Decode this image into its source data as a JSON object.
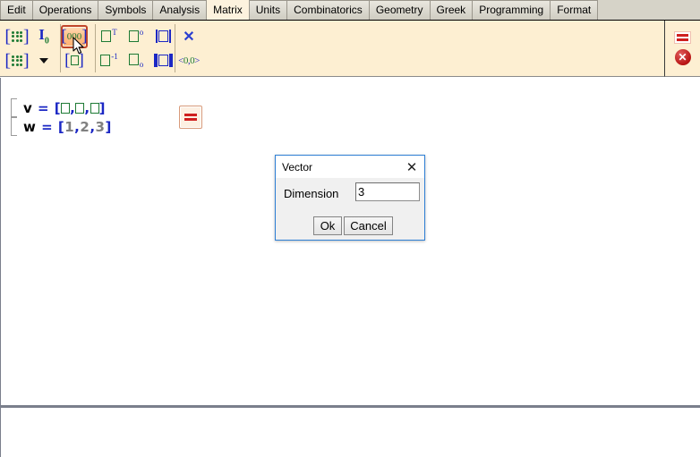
{
  "tabs": [
    {
      "label": "Edit",
      "active": false
    },
    {
      "label": "Operations",
      "active": false
    },
    {
      "label": "Symbols",
      "active": false
    },
    {
      "label": "Analysis",
      "active": false
    },
    {
      "label": "Matrix",
      "active": true
    },
    {
      "label": "Units",
      "active": false
    },
    {
      "label": "Combinatorics",
      "active": false
    },
    {
      "label": "Geometry",
      "active": false
    },
    {
      "label": "Greek",
      "active": false
    },
    {
      "label": "Programming",
      "active": false
    },
    {
      "label": "Format",
      "active": false
    }
  ],
  "toolbar": {
    "buttons": [
      {
        "name": "matrix-grid-button",
        "tooltip": "Matrix"
      },
      {
        "name": "matrix-grid-small-button",
        "tooltip": "Matrix"
      },
      {
        "name": "identity-matrix-button",
        "tooltip": "Identity"
      },
      {
        "name": "matrix-dropdown-button",
        "tooltip": "More"
      },
      {
        "name": "vector-row-button",
        "tooltip": "Vector",
        "selected": true
      },
      {
        "name": "vector-column-button",
        "tooltip": "Vector column"
      },
      {
        "name": "transpose-button",
        "tooltip": "Transpose"
      },
      {
        "name": "inverse-button",
        "tooltip": "Inverse"
      },
      {
        "name": "conjugate-button",
        "tooltip": "Conjugate"
      },
      {
        "name": "subscript-index-button",
        "tooltip": "Index"
      },
      {
        "name": "determinant-button",
        "tooltip": "Determinant"
      },
      {
        "name": "norm-button",
        "tooltip": "Norm"
      },
      {
        "name": "cross-product-button",
        "tooltip": "Cross product"
      },
      {
        "name": "scalar-product-button",
        "tooltip": "Scalar product"
      }
    ],
    "right_buttons": [
      {
        "name": "equals-toggle-button"
      },
      {
        "name": "close-toolbar-button"
      }
    ]
  },
  "worksheet": {
    "lines": [
      {
        "id": "line-v",
        "parts": [
          {
            "text": "v",
            "kind": "var"
          },
          {
            "text": " = ",
            "kind": "op"
          },
          {
            "text": "[",
            "kind": "op"
          },
          {
            "text": "",
            "kind": "placeholder"
          },
          {
            "text": ",",
            "kind": "op"
          },
          {
            "text": "",
            "kind": "placeholder"
          },
          {
            "text": ",",
            "kind": "op"
          },
          {
            "text": "",
            "kind": "placeholder"
          },
          {
            "text": "]",
            "kind": "op"
          }
        ],
        "plain": "v = [□,□,□]"
      },
      {
        "id": "line-w",
        "parts": [
          {
            "text": "w",
            "kind": "var"
          },
          {
            "text": " = ",
            "kind": "op"
          },
          {
            "text": "[",
            "kind": "op"
          },
          {
            "text": "1",
            "kind": "num"
          },
          {
            "text": ",",
            "kind": "op"
          },
          {
            "text": "2",
            "kind": "num"
          },
          {
            "text": ",",
            "kind": "op"
          },
          {
            "text": "3",
            "kind": "num"
          },
          {
            "text": "]",
            "kind": "op"
          }
        ],
        "plain": "w = [1,2,3]"
      }
    ],
    "inline_button": {
      "name": "equals-result-button",
      "label": "="
    }
  },
  "dialog": {
    "title": "Vector",
    "close_label": "✕",
    "field_label": "Dimension",
    "field_value": "3",
    "field_placeholder": "",
    "ok_label": "Ok",
    "cancel_label": "Cancel"
  },
  "colors": {
    "toolbar_bg": "#fdefd2",
    "tab_active_bg": "#fdf2de",
    "tabbar_bg": "#d6d3c8",
    "selection_accent": "#c0462a",
    "operator_blue": "#1b27c4",
    "placeholder_green": "#1d7a34",
    "number_gray": "#808080",
    "dialog_border": "#2e7fd4",
    "close_red": "#b81414"
  }
}
